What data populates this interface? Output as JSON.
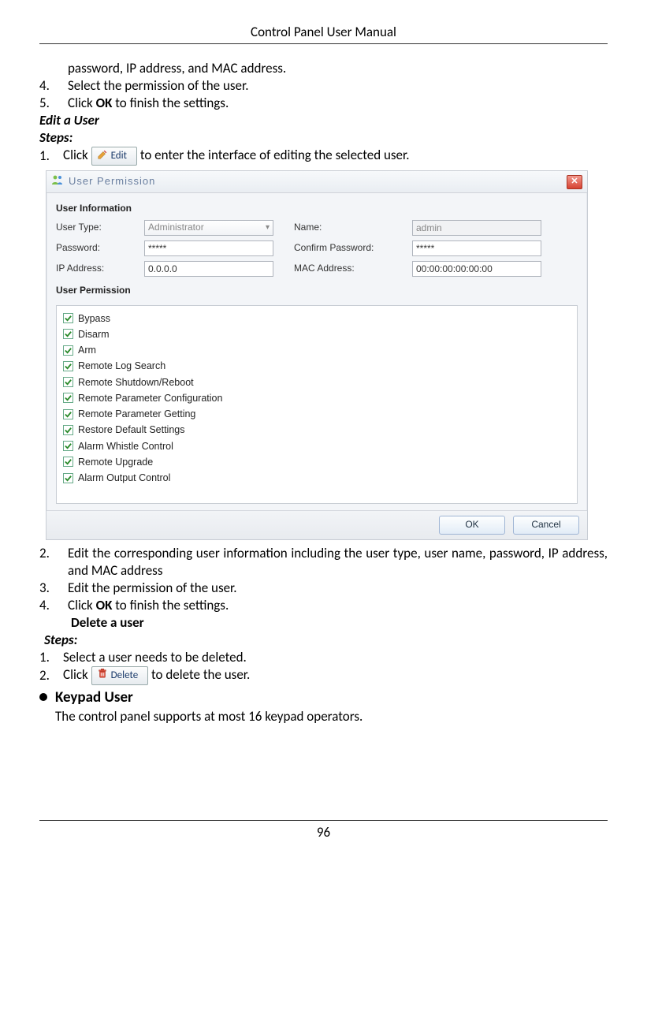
{
  "header": {
    "title": "Control Panel User Manual"
  },
  "footer": {
    "page": "96"
  },
  "intro_cont": "password, IP address, and MAC address.",
  "intro_steps": {
    "s4_num": "4.",
    "s4_text": "Select the permission of the user.",
    "s5_num": "5.",
    "s5_pre": "Click ",
    "s5_ok": "OK",
    "s5_post": " to finish the settings."
  },
  "edit_user": {
    "heading": "Edit a User",
    "steps_label": "Steps:",
    "s1_num": "1.",
    "s1_pre": "Click ",
    "s1_post": "to enter the interface of editing the selected user."
  },
  "edit_btn": {
    "label": "Edit"
  },
  "dialog": {
    "title": "User Permission",
    "sect_info": "User Information",
    "user_type_lbl": "User Type:",
    "user_type_val": "Administrator",
    "name_lbl": "Name:",
    "name_val": "admin",
    "pwd_lbl": "Password:",
    "pwd_val": "*****",
    "cpwd_lbl": "Confirm Password:",
    "cpwd_val": "*****",
    "ip_lbl": "IP Address:",
    "ip_val": "0.0.0.0",
    "mac_lbl": "MAC Address:",
    "mac_val": "00:00:00:00:00:00",
    "sect_perm": "User Permission",
    "perms": [
      "Bypass",
      "Disarm",
      "Arm",
      "Remote Log Search",
      "Remote Shutdown/Reboot",
      "Remote Parameter Configuration",
      "Remote Parameter Getting",
      "Restore Default Settings",
      "Alarm Whistle Control",
      "Remote Upgrade",
      "Alarm Output Control"
    ],
    "ok": "OK",
    "cancel": "Cancel"
  },
  "after_dialog": {
    "s2_num": "2.",
    "s2_text": "Edit the corresponding user information including the user type, user name, password, IP address, and MAC address",
    "s3_num": "3.",
    "s3_text": "Edit the permission of the user.",
    "s4_num": "4.",
    "s4_pre": "Click ",
    "s4_ok": "OK",
    "s4_post": " to finish the settings."
  },
  "delete_user": {
    "heading": "Delete a user",
    "steps_label": "Steps:",
    "s1_num": "1.",
    "s1_text": "Select a user needs to be deleted.",
    "s2_num": "2.",
    "s2_pre": "Click ",
    "s2_post": " to delete the user."
  },
  "delete_btn": {
    "label": "Delete"
  },
  "keypad": {
    "heading": "Keypad User",
    "text": "The control panel supports at most 16 keypad operators."
  }
}
